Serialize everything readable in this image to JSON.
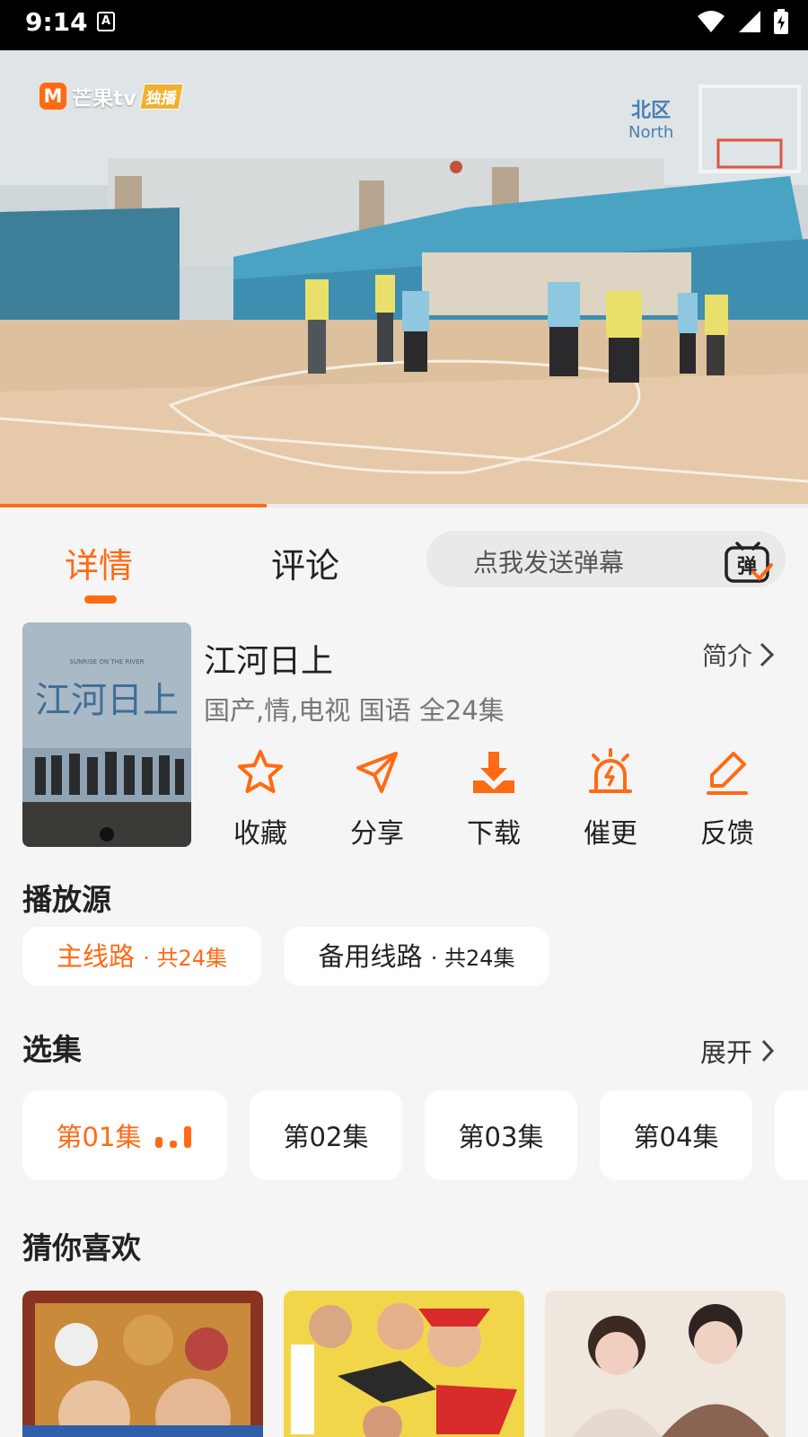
{
  "status_bar": {
    "time": "9:14",
    "notification_letter": "A"
  },
  "player": {
    "brand_letter": "M",
    "brand_name": "芒果tv",
    "brand_tag": "独播",
    "scene_sign": "北区",
    "scene_sign_sub": "North",
    "progress": 0.33,
    "accent": "#ff6a13"
  },
  "tabs": [
    {
      "label": "详情",
      "active": true
    },
    {
      "label": "评论",
      "active": false
    }
  ],
  "danmaku": {
    "placeholder": "点我发送弹幕",
    "icon_glyph": "弹"
  },
  "show": {
    "poster_caption": "SUNRISE ON THE RIVER",
    "poster_title": "江河日上",
    "title": "江河日上",
    "intro_label": "简介",
    "meta": "国产,情,电视 国语 全24集"
  },
  "actions": [
    {
      "label": "收藏",
      "icon": "star-icon"
    },
    {
      "label": "分享",
      "icon": "send-icon"
    },
    {
      "label": "下载",
      "icon": "download-icon"
    },
    {
      "label": "催更",
      "icon": "alarm-icon"
    },
    {
      "label": "反馈",
      "icon": "edit-icon"
    }
  ],
  "sources": {
    "title": "播放源",
    "items": [
      {
        "name": "主线路",
        "count": "· 共24集",
        "active": true
      },
      {
        "name": "备用线路",
        "count": "· 共24集",
        "active": false
      }
    ]
  },
  "episodes": {
    "title": "选集",
    "expand_label": "展开",
    "items": [
      {
        "label": "第01集",
        "active": true
      },
      {
        "label": "第02集",
        "active": false
      },
      {
        "label": "第03集",
        "active": false
      },
      {
        "label": "第04集",
        "active": false
      }
    ]
  },
  "recommendations": {
    "title": "猜你喜欢"
  }
}
